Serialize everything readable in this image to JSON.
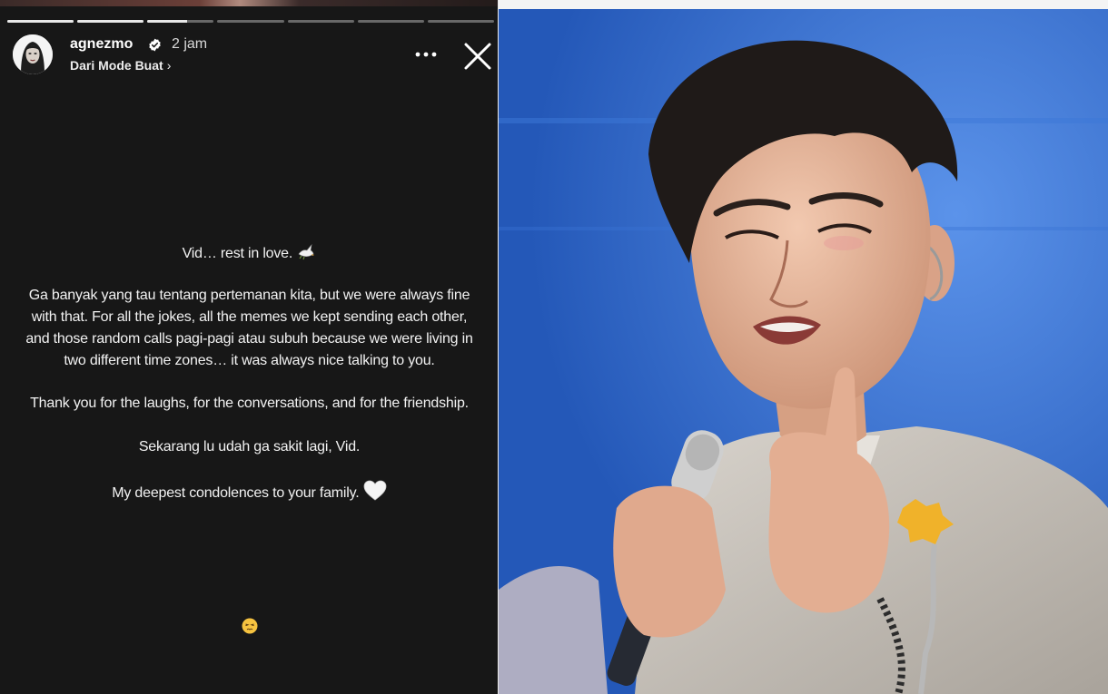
{
  "story": {
    "progress_segments": [
      1,
      1,
      0.6,
      0,
      0,
      0,
      0
    ],
    "username": "agnezmo",
    "time": "2 jam",
    "subline": "Dari Mode Buat",
    "subline_chevron": "›",
    "icons": {
      "avatar": "profile-avatar",
      "verified": "verified-badge-icon",
      "more": "more-options-icon",
      "close": "close-icon",
      "dove": "dove-emoji",
      "heart": "white-heart-emoji",
      "bottom": "persevering-face-emoji"
    },
    "message": {
      "line_1": "Vid… rest in love.",
      "para_2_line_1": "Ga banyak yang tau tentang pertemanan kita, but we were always fine",
      "para_2_line_2": "with that. For all the jokes, all the memes we kept sending each other,",
      "para_2_line_3": "and those random calls pagi-pagi atau subuh because we were living in",
      "para_2_line_4": "two different time zones… it was always nice talking to you.",
      "para_3": "Thank you for the laughs, for the conversations, and for the friendship.",
      "para_4": "Sekarang lu udah ga sakit lagi, Vid.",
      "para_5": "My deepest condolences to your family."
    }
  },
  "photo": {
    "description_icon": "performer-with-microphone-photo",
    "colors": {
      "stage_blue": "#2a62c8",
      "suit": "#c8c3bc",
      "skin": "#e4b59a",
      "hair": "#1f1a18"
    }
  }
}
